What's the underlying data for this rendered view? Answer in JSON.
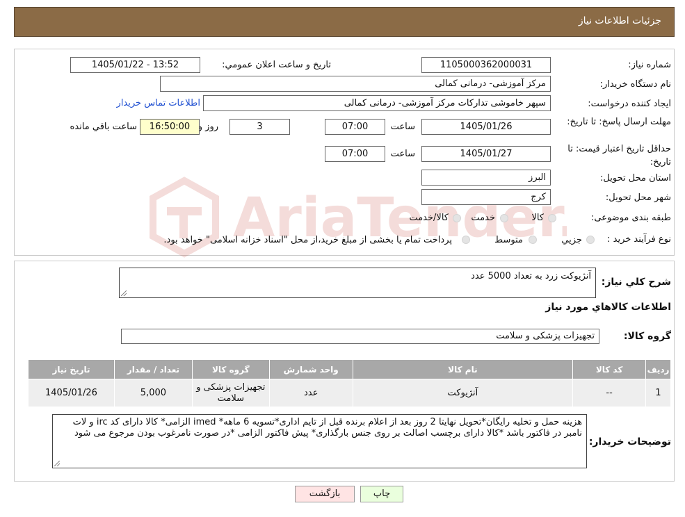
{
  "header": {
    "title": "جزئیات اطلاعات نیاز"
  },
  "form": {
    "need_number_label": "شماره نیاز:",
    "need_number": "1105000362000031",
    "announce_label": "تاریخ و ساعت اعلان عمومي:",
    "announce_value": "1405/01/22 - 13:52",
    "buyer_org_label": "نام دستگاه خريدار:",
    "buyer_org": "مرکز آموزشی- درمانی کمالی",
    "creator_label": "ايجاد کننده درخواست:",
    "creator": "سپهر خاموشی تدارکات مرکز آموزشی- درمانی کمالی",
    "contact_link": "اطلاعات تماس خريدار",
    "deadline_label": "مهلت ارسال پاسخ: تا تاريخ:",
    "deadline_date": "1405/01/26",
    "time_label": "ساعت",
    "deadline_time": "07:00",
    "days_value": "3",
    "days_label": "روز و",
    "remaining_time": "16:50:00",
    "remaining_label": "ساعت باقي مانده",
    "validity_label": "حداقل تاريخ اعتبار قيمت: تا تاريخ:",
    "validity_date": "1405/01/27",
    "validity_time": "07:00",
    "province_label": "استان محل تحويل:",
    "province": "البرز",
    "city_label": "شهر محل تحويل:",
    "city": "کرج",
    "category_label": "طبقه بندی موضوعی:",
    "category_options": [
      "کالا",
      "خدمت",
      "کالا/خدمت"
    ],
    "process_label": "نوع فرآيند خريد :",
    "process_options": [
      "جزيي",
      "متوسط"
    ],
    "process_note": "پرداخت تمام يا بخشی از مبلغ خريد،از محل \"اسناد خزانه اسلامی\" خواهد بود."
  },
  "summary": {
    "label": "شرح كلي نياز:",
    "value": "آنژیوکت زرد به تعداد 5000 عدد"
  },
  "goods_section_title": "اطلاعات كالاهاي مورد نياز",
  "goods_group": {
    "label": "گروه كالا:",
    "value": "تجهیزات پزشکی و سلامت"
  },
  "table": {
    "headers": [
      "رديف",
      "كد كالا",
      "نام كالا",
      "واحد شمارش",
      "گروه كالا",
      "تعداد / مقدار",
      "تاريخ نياز"
    ],
    "rows": [
      [
        "1",
        "--",
        "آنژیوکت",
        "عدد",
        "تجهیزات پزشکی و سلامت",
        "5,000",
        "1405/01/26"
      ]
    ]
  },
  "buyer_notes": {
    "label": "توضيحات خريدار:",
    "value": "هزینه حمل و تخلیه رایگان*تحویل نهایتا 2 روز بعد از اعلام برنده قبل از تایم اداری*تسویه 6 ماهه* imed الزامی* کالا دارای کد irc و لات نامبر در فاکتور باشد *کالا دارای برچسب اصالت بر روی جنس بارگذاری* پیش فاکتور الزامی *در صورت نامرغوب بودن مرجوع می شود"
  },
  "buttons": {
    "print": "چاپ",
    "back": "بازگشت"
  },
  "watermark": {
    "text": "AriaTender.neT"
  },
  "colors": {
    "header": "#8b6b46",
    "table_header": "#a8a8a8",
    "link": "#1f4fd1"
  }
}
